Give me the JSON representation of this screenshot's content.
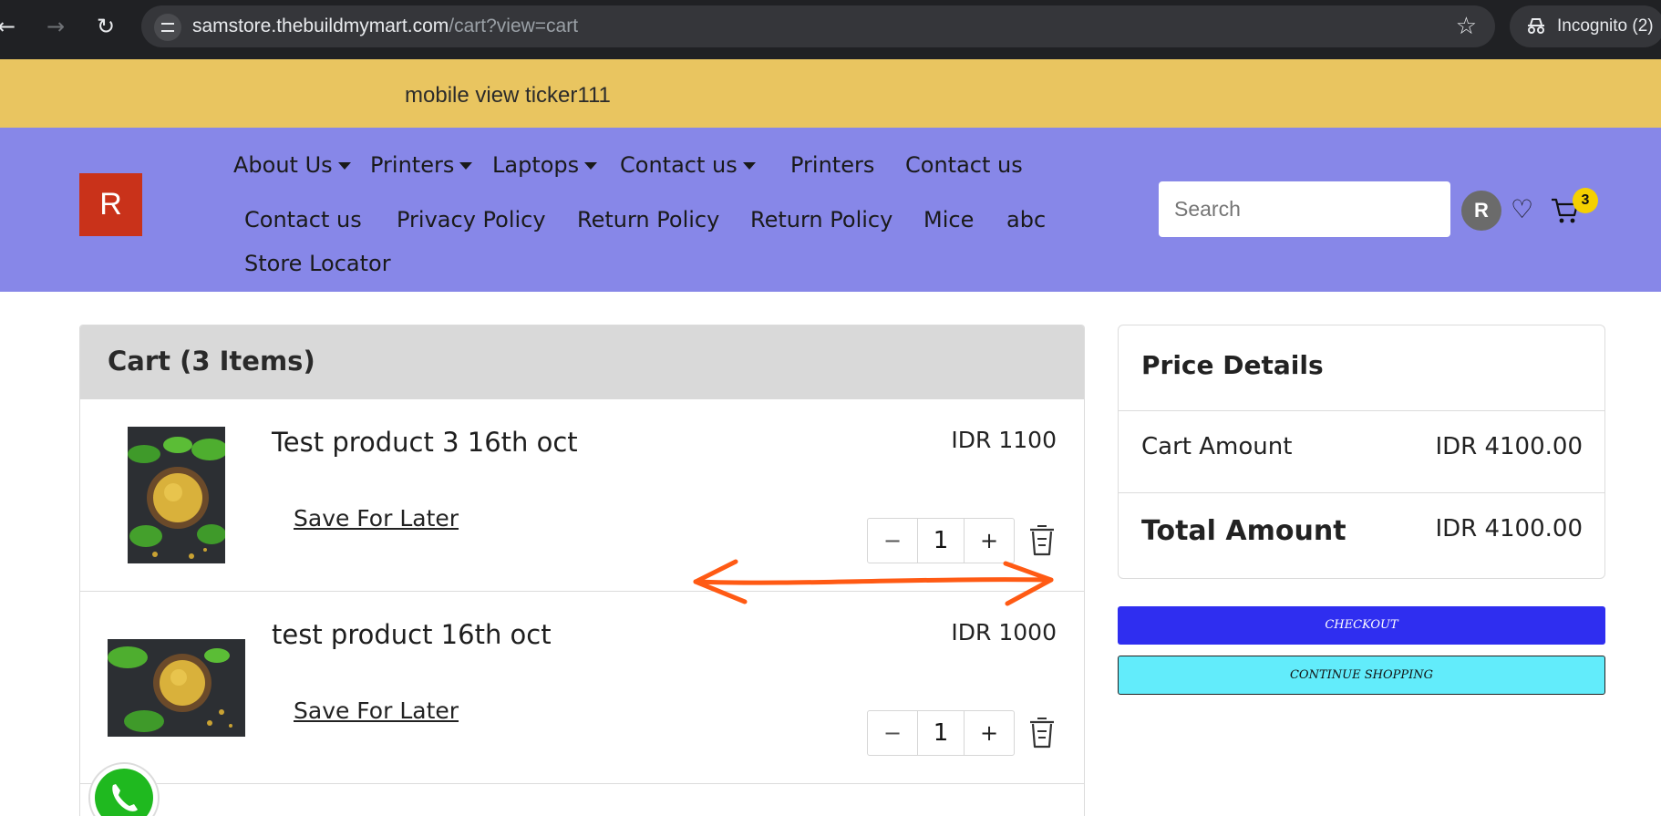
{
  "browser": {
    "url_host": "samstore.thebuildmymart.com",
    "url_path": "/cart?view=cart",
    "incognito_label": "Incognito (2)"
  },
  "ticker": {
    "text": "mobile view ticker111"
  },
  "header": {
    "logo_letter": "R",
    "nav_row1": [
      "About Us",
      "Printers",
      "Laptops",
      "Contact us",
      "Printers",
      "Contact us"
    ],
    "nav_row2": [
      "Contact us",
      "Privacy Policy",
      "Return Policy",
      "Return Policy",
      "Mice",
      "abc"
    ],
    "nav_row3": [
      "Store Locator"
    ],
    "search_placeholder": "Search",
    "avatar_letter": "R",
    "cart_count": "3"
  },
  "cart": {
    "title": "Cart (3 Items)",
    "save_for_later_label": "Save For Later",
    "items": [
      {
        "name": "Test product 3 16th oct",
        "price": "IDR 1100",
        "qty": "1"
      },
      {
        "name": "test product 16th oct",
        "price": "IDR 1000",
        "qty": "1"
      }
    ]
  },
  "price_details": {
    "title": "Price Details",
    "cart_amount_label": "Cart Amount",
    "cart_amount_value": "IDR 4100.00",
    "total_amount_label": "Total Amount",
    "total_amount_value": "IDR 4100.00"
  },
  "buttons": {
    "checkout": "CHECKOUT",
    "continue_shopping": "CONTINUE SHOPPING"
  },
  "colors": {
    "ticker_bg": "#e9c560",
    "header_bg": "#8787e8",
    "logo_bg": "#c9321a",
    "checkout_bg": "#2f2ef0",
    "continue_bg": "#62ecfb",
    "annotation_arrow": "#ff5a14",
    "cart_badge": "#f5d000"
  }
}
